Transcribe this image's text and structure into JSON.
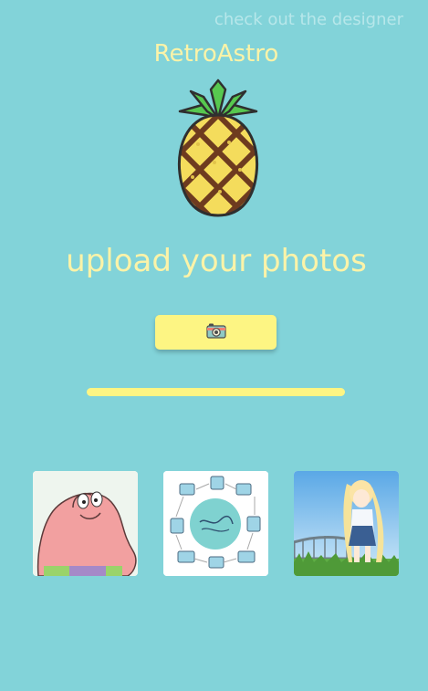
{
  "header": {
    "designer_link": "check out the designer"
  },
  "brand": {
    "name": "RetroAstro",
    "logo_icon": "pineapple-icon"
  },
  "main": {
    "headline": "upload your photos",
    "upload_button_icon": "camera-icon",
    "progress_fraction": 1.0
  },
  "gallery": {
    "photos": [
      {
        "subject": "cartoon starfish character"
      },
      {
        "subject": "illustrated product design cycle diagram"
      },
      {
        "subject": "anime girl in a grassy field with bridge"
      }
    ]
  },
  "colors": {
    "background": "#82d3d9",
    "accent_yellow": "#fdf583",
    "text_cream": "#fbf3a8",
    "link_light": "#b7e7ea"
  }
}
